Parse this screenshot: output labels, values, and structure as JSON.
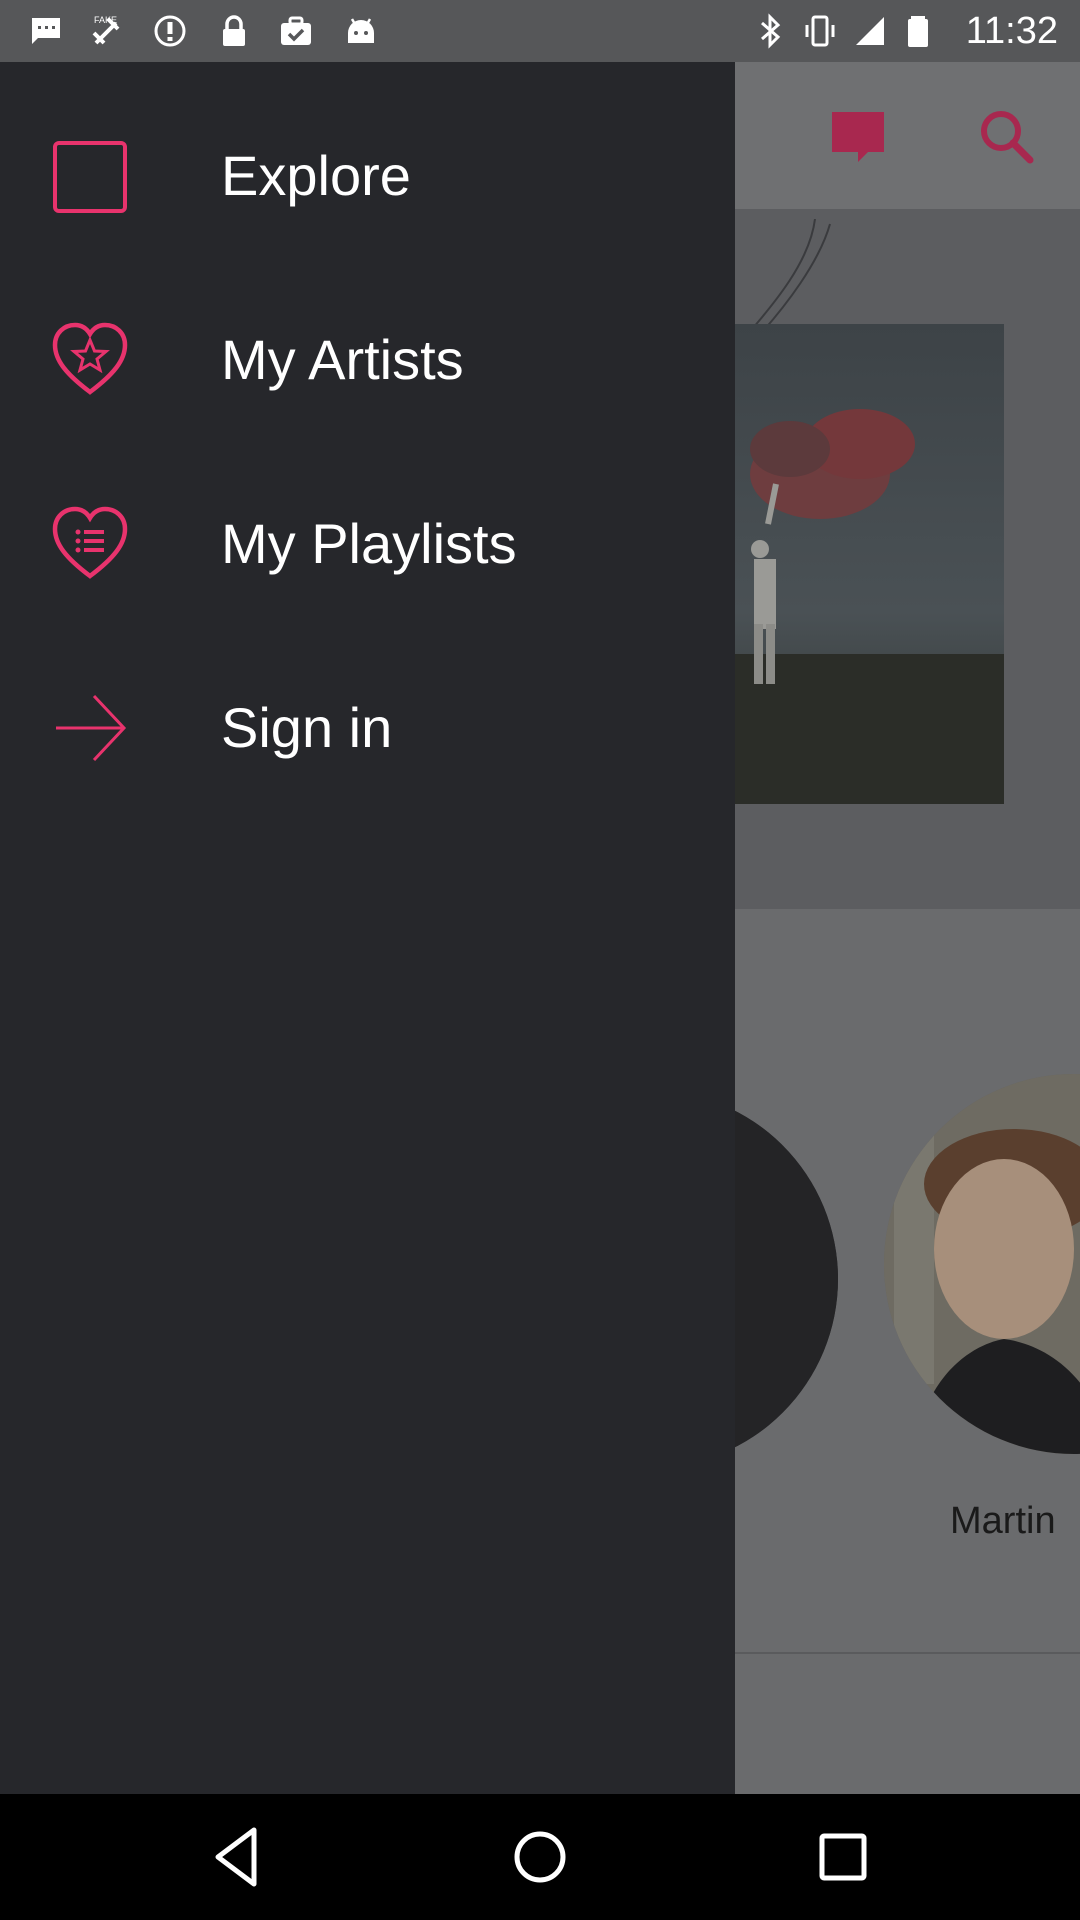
{
  "status_bar": {
    "time": "11:32",
    "left_icons": [
      "message-icon",
      "fake-gps-icon",
      "info-icon",
      "lock-icon",
      "briefcase-check-icon",
      "android-icon"
    ],
    "right_icons": [
      "bluetooth-icon",
      "vibrate-icon",
      "signal-icon",
      "battery-icon"
    ]
  },
  "app": {
    "toolbar_icons": [
      "chat-icon",
      "search-icon"
    ],
    "accent_color": "#e8336d",
    "artists": {
      "visible_name": "Martin"
    }
  },
  "drawer": {
    "items": [
      {
        "label": "Explore",
        "icon": "square-outline-icon"
      },
      {
        "label": "My Artists",
        "icon": "heart-star-icon"
      },
      {
        "label": "My Playlists",
        "icon": "heart-list-icon"
      },
      {
        "label": "Sign in",
        "icon": "arrow-right-icon"
      }
    ]
  },
  "nav_bar": {
    "buttons": [
      "back-icon",
      "home-icon",
      "recents-icon"
    ]
  }
}
